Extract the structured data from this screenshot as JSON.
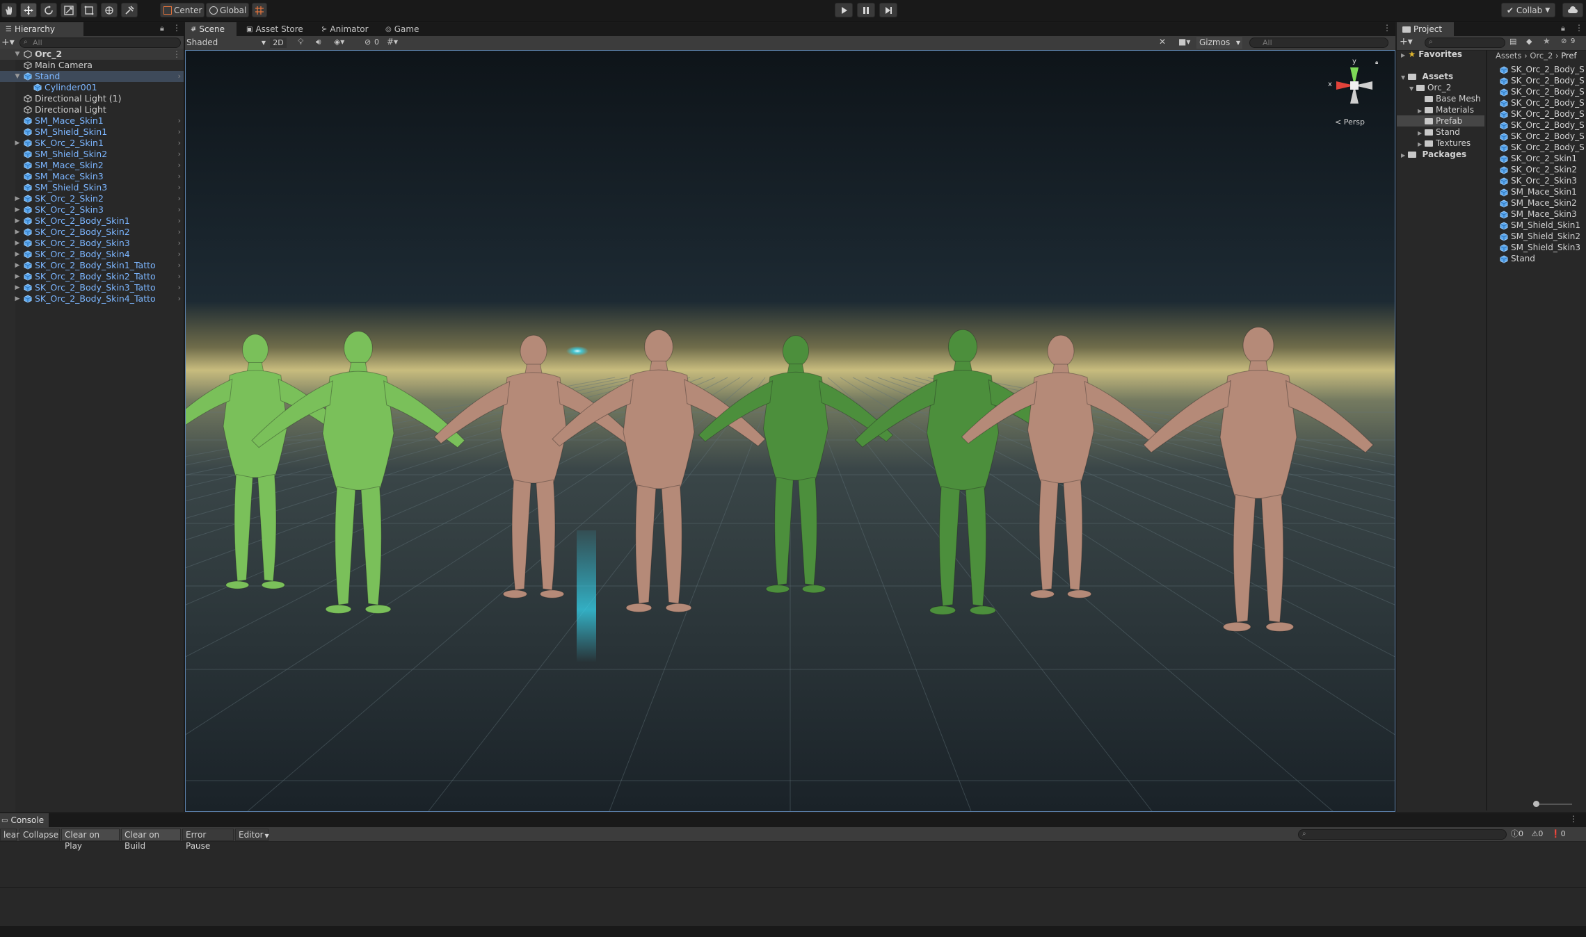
{
  "toolbar": {
    "pivot_label": "Center",
    "space_label": "Global",
    "collab_label": "Collab"
  },
  "hierarchy": {
    "tab_label": "Hierarchy",
    "search_placeholder": "All",
    "root": "Orc_2",
    "items": [
      {
        "label": "Main Camera",
        "indent": 1,
        "type": "object",
        "expandable": false,
        "prefab": false
      },
      {
        "label": "Stand",
        "indent": 1,
        "type": "prefab",
        "expandable": true,
        "expanded": true,
        "prefab": true,
        "selected": true
      },
      {
        "label": "Cylinder001",
        "indent": 2,
        "type": "object",
        "expandable": false,
        "prefab": true
      },
      {
        "label": "Directional Light (1)",
        "indent": 1,
        "type": "object",
        "expandable": false,
        "prefab": false
      },
      {
        "label": "Directional Light",
        "indent": 1,
        "type": "object",
        "expandable": false,
        "prefab": false
      },
      {
        "label": "SM_Mace_Skin1",
        "indent": 1,
        "type": "prefab",
        "expandable": false,
        "prefab": true
      },
      {
        "label": "SM_Shield_Skin1",
        "indent": 1,
        "type": "prefab",
        "expandable": false,
        "prefab": true
      },
      {
        "label": "SK_Orc_2_Skin1",
        "indent": 1,
        "type": "prefab",
        "expandable": true,
        "prefab": true
      },
      {
        "label": "SM_Shield_Skin2",
        "indent": 1,
        "type": "prefab",
        "expandable": false,
        "prefab": true
      },
      {
        "label": "SM_Mace_Skin2",
        "indent": 1,
        "type": "prefab",
        "expandable": false,
        "prefab": true
      },
      {
        "label": "SM_Mace_Skin3",
        "indent": 1,
        "type": "prefab",
        "expandable": false,
        "prefab": true
      },
      {
        "label": "SM_Shield_Skin3",
        "indent": 1,
        "type": "prefab",
        "expandable": false,
        "prefab": true
      },
      {
        "label": "SK_Orc_2_Skin2",
        "indent": 1,
        "type": "prefab",
        "expandable": true,
        "prefab": true
      },
      {
        "label": "SK_Orc_2_Skin3",
        "indent": 1,
        "type": "prefab",
        "expandable": true,
        "prefab": true
      },
      {
        "label": "SK_Orc_2_Body_Skin1",
        "indent": 1,
        "type": "prefab",
        "expandable": true,
        "prefab": true
      },
      {
        "label": "SK_Orc_2_Body_Skin2",
        "indent": 1,
        "type": "prefab",
        "expandable": true,
        "prefab": true
      },
      {
        "label": "SK_Orc_2_Body_Skin3",
        "indent": 1,
        "type": "prefab",
        "expandable": true,
        "prefab": true
      },
      {
        "label": "SK_Orc_2_Body_Skin4",
        "indent": 1,
        "type": "prefab",
        "expandable": true,
        "prefab": true
      },
      {
        "label": "SK_Orc_2_Body_Skin1_Tatto",
        "indent": 1,
        "type": "prefab",
        "expandable": true,
        "prefab": true
      },
      {
        "label": "SK_Orc_2_Body_Skin2_Tatto",
        "indent": 1,
        "type": "prefab",
        "expandable": true,
        "prefab": true
      },
      {
        "label": "SK_Orc_2_Body_Skin3_Tatto",
        "indent": 1,
        "type": "prefab",
        "expandable": true,
        "prefab": true
      },
      {
        "label": "SK_Orc_2_Body_Skin4_Tatto",
        "indent": 1,
        "type": "prefab",
        "expandable": true,
        "prefab": true
      }
    ]
  },
  "scene": {
    "tabs": [
      "Scene",
      "Asset Store",
      "Animator",
      "Game"
    ],
    "shading_mode": "Shaded",
    "mode_2d": "2D",
    "hidden_count": "0",
    "gizmos_label": "Gizmos",
    "search_placeholder": "All",
    "projection_label": "Persp",
    "axis_x": "x",
    "axis_y": "y",
    "colors": {
      "horizon": "#c8bc7e",
      "sky_top": "#0e1419",
      "ground": "#1a2228",
      "green_orc": "#4c8f3c",
      "light_green_orc": "#7ac05a",
      "skin_orc": "#b58a78",
      "cyan_light": "#35d6f0"
    }
  },
  "project": {
    "tab_label": "Project",
    "favorites_label": "Favorites",
    "assets_label": "Assets",
    "packages_label": "Packages",
    "tree": [
      {
        "label": "Orc_2",
        "indent": 1,
        "expanded": true
      },
      {
        "label": "Base Mesh",
        "indent": 2
      },
      {
        "label": "Materials",
        "indent": 2,
        "expandable": true
      },
      {
        "label": "Prefab",
        "indent": 2,
        "selected": true
      },
      {
        "label": "Stand",
        "indent": 2,
        "expandable": true
      },
      {
        "label": "Textures",
        "indent": 2,
        "expandable": true
      }
    ],
    "breadcrumb": [
      "Assets",
      "Orc_2",
      "Pref"
    ],
    "hidden_count": "9",
    "files": [
      "SK_Orc_2_Body_S",
      "SK_Orc_2_Body_S",
      "SK_Orc_2_Body_S",
      "SK_Orc_2_Body_S",
      "SK_Orc_2_Body_S",
      "SK_Orc_2_Body_S",
      "SK_Orc_2_Body_S",
      "SK_Orc_2_Body_S",
      "SK_Orc_2_Skin1",
      "SK_Orc_2_Skin2",
      "SK_Orc_2_Skin3",
      "SM_Mace_Skin1",
      "SM_Mace_Skin2",
      "SM_Mace_Skin3",
      "SM_Shield_Skin1",
      "SM_Shield_Skin2",
      "SM_Shield_Skin3",
      "Stand"
    ]
  },
  "console": {
    "tab_label": "Console",
    "buttons": [
      "lear",
      "Collapse",
      "Clear on Play",
      "Clear on Build",
      "Error Pause",
      "Editor"
    ],
    "info_count": "0",
    "warning_count": "0",
    "error_count": "0"
  }
}
